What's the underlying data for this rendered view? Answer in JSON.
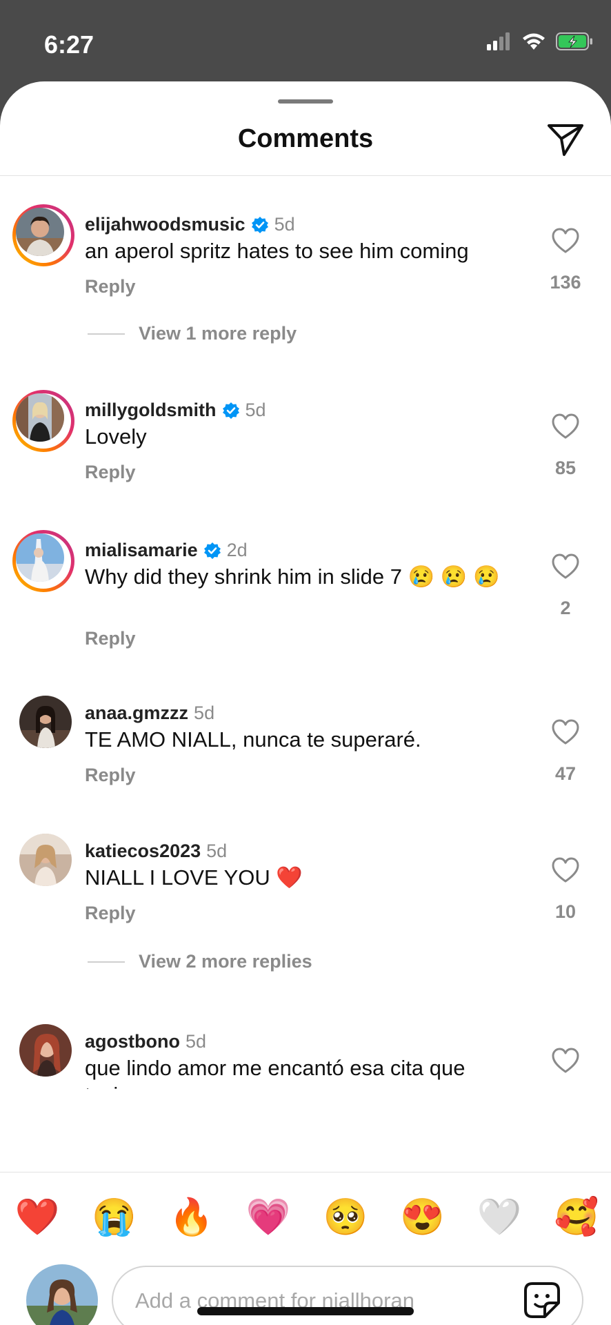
{
  "status": {
    "time": "6:27"
  },
  "header": {
    "title": "Comments"
  },
  "comments": [
    {
      "user": "elijahwoodsmusic",
      "verified": true,
      "time": "5d",
      "text": "an aperol spritz hates to see him coming",
      "reply": "Reply",
      "likes": "136",
      "view_more": "View 1 more reply"
    },
    {
      "user": "millygoldsmith",
      "verified": true,
      "time": "5d",
      "text": "Lovely",
      "reply": "Reply",
      "likes": "85"
    },
    {
      "user": "mialisamarie",
      "verified": true,
      "time": "2d",
      "text": "Why did they shrink him in slide 7 😢 😢 😢",
      "reply": "Reply",
      "likes": "2"
    },
    {
      "user": "anaa.gmzzz",
      "verified": false,
      "time": "5d",
      "text": "TE AMO NIALL, nunca te superaré.",
      "reply": "Reply",
      "likes": "47"
    },
    {
      "user": "katiecos2023",
      "verified": false,
      "time": "5d",
      "text": "NIALL I LOVE YOU ❤️",
      "reply": "Reply",
      "likes": "10",
      "view_more": "View 2 more replies"
    },
    {
      "user": "agostbono",
      "verified": false,
      "time": "5d",
      "text": "que lindo amor me encantó esa cita que tuvimos"
    }
  ],
  "reactions": [
    "❤️",
    "😭",
    "🔥",
    "💗",
    "🥺",
    "😍",
    "🤍",
    "🥰"
  ],
  "composer": {
    "placeholder": "Add a comment for niallhoran"
  },
  "colors": {
    "verified": "#0095f6",
    "muted": "#8a8a8a",
    "ring": "#e1306c"
  }
}
